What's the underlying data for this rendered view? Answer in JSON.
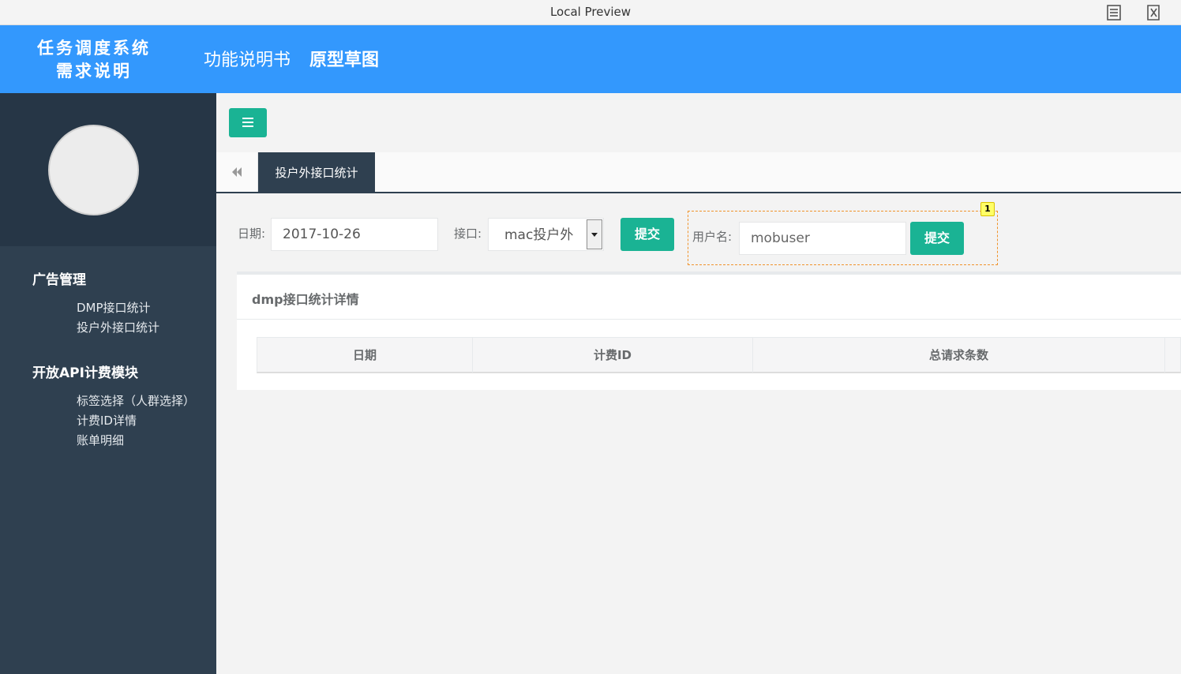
{
  "window": {
    "title": "Local Preview",
    "icons": [
      "notes-icon",
      "close-icon"
    ]
  },
  "header": {
    "logo_line1": "任务调度系统",
    "logo_line2": "需求说明",
    "nav": [
      "功能说明书",
      "原型草图"
    ],
    "background": "#3398fd"
  },
  "sidebar": {
    "groups": [
      {
        "title": "广告管理",
        "items": [
          "DMP接口统计",
          "投户外接口统计"
        ]
      },
      {
        "title": "开放API计费模块",
        "items": [
          "标签选择（人群选择）",
          "计费ID详情",
          "账单明细"
        ]
      }
    ],
    "background": "#2f4050"
  },
  "tabs": {
    "active": "投户外接口统计"
  },
  "filters": {
    "date_label": "日期:",
    "date_value": "2017-10-26",
    "api_label": "接口:",
    "api_selected": "mac投户外",
    "submit_label": "提交",
    "user_label": "用户名:",
    "user_value": "mobuser",
    "submit2_label": "提交",
    "annotation_badge": "1"
  },
  "panel": {
    "title": "dmp接口统计详情",
    "columns": [
      "日期",
      "计费ID",
      "总请求条数",
      ""
    ]
  },
  "colors": {
    "accent": "#1ab394",
    "annotation": "#f0932b"
  }
}
